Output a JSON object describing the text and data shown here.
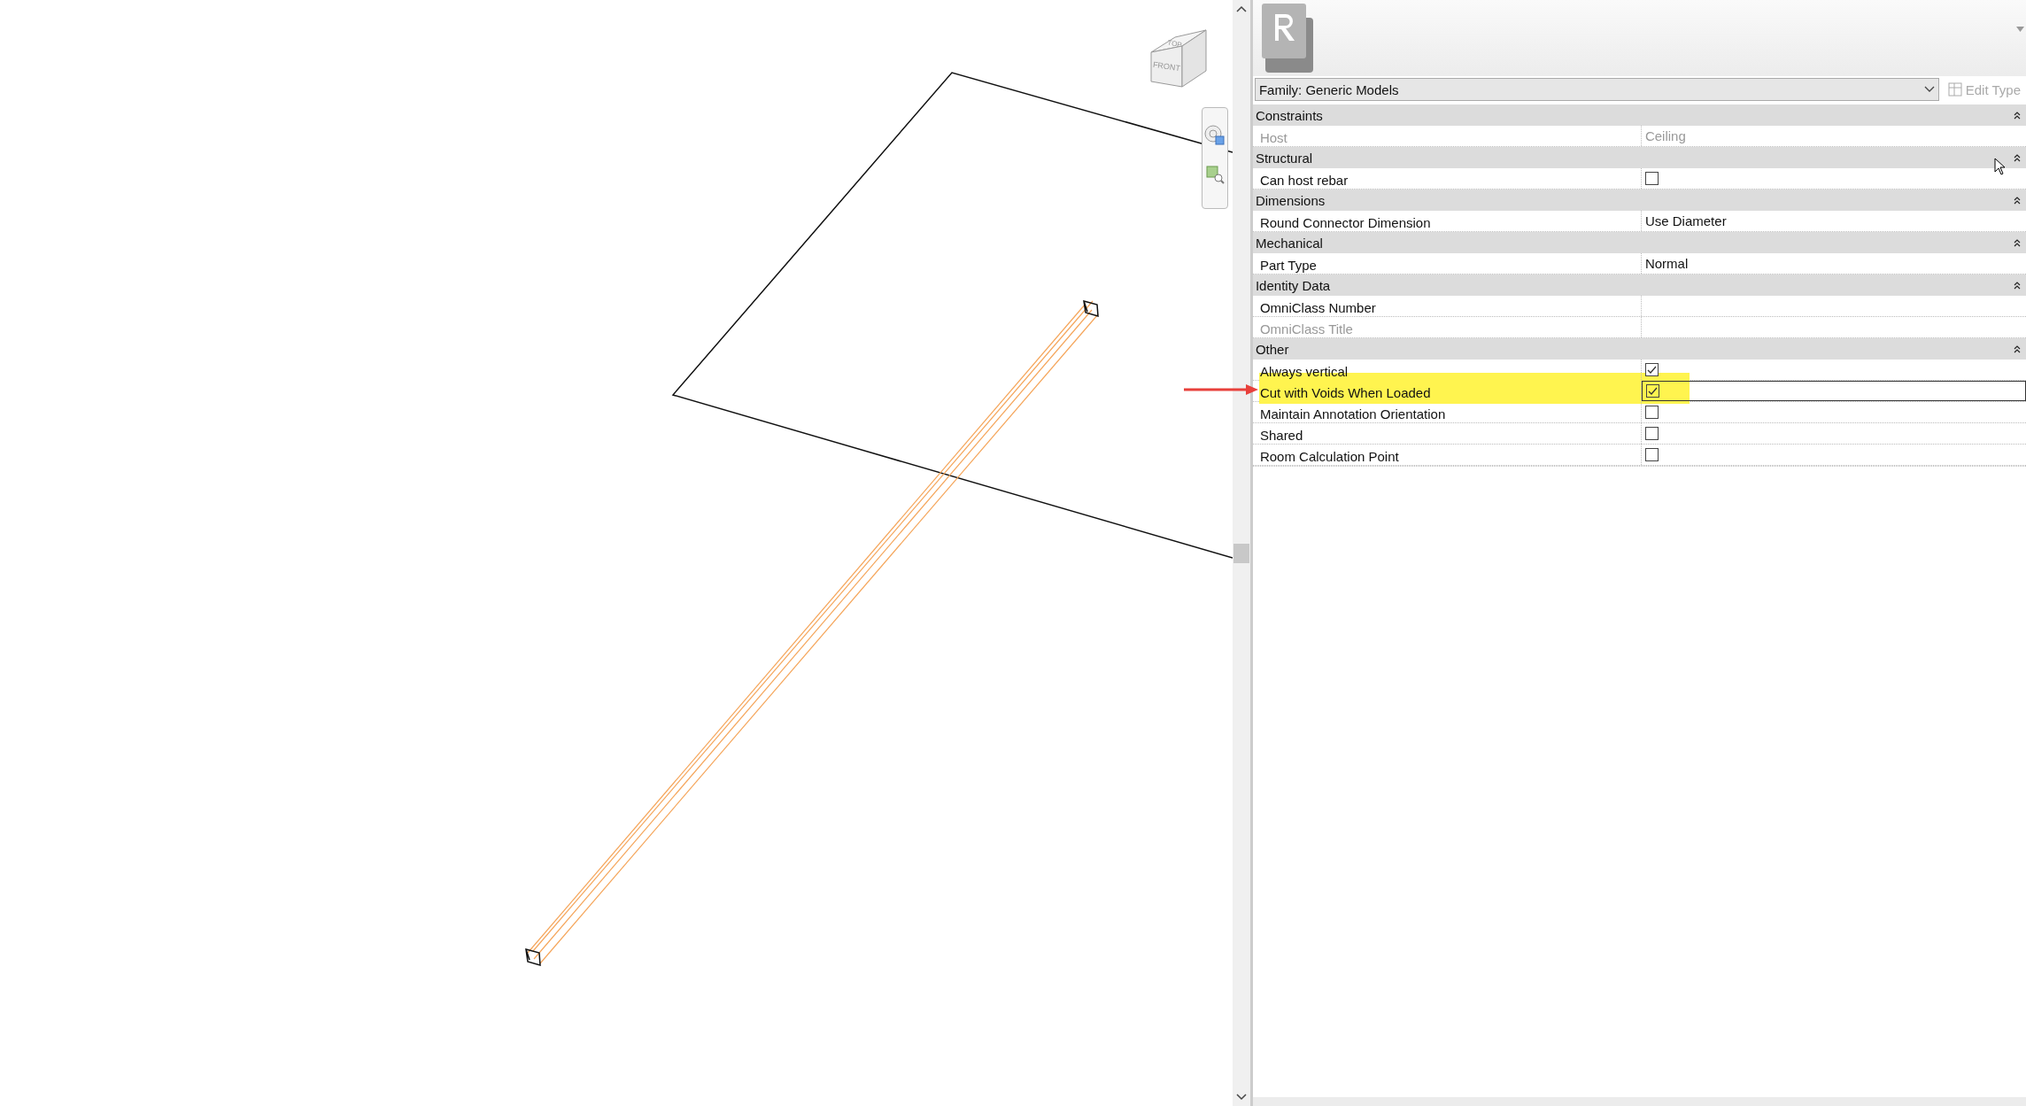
{
  "viewport": {
    "view_cube": {
      "faces": [
        "TOP",
        "FRONT"
      ]
    }
  },
  "properties": {
    "type_selector": "Family: Generic Models",
    "edit_type": {
      "label": "Edit Type",
      "disabled": true
    },
    "groups": [
      {
        "name": "Constraints",
        "expanded": true,
        "rows": [
          {
            "kind": "text",
            "label": "Host",
            "value": "Ceiling",
            "disabled": true,
            "selected": false,
            "highlighted": false
          }
        ]
      },
      {
        "name": "Structural",
        "expanded": true,
        "rows": [
          {
            "kind": "checkbox",
            "label": "Can host rebar",
            "checked": false,
            "disabled": false,
            "selected": false,
            "highlighted": false
          }
        ]
      },
      {
        "name": "Dimensions",
        "expanded": true,
        "rows": [
          {
            "kind": "text",
            "label": "Round Connector Dimension",
            "value": "Use Diameter",
            "disabled": false,
            "selected": false,
            "highlighted": false
          }
        ]
      },
      {
        "name": "Mechanical",
        "expanded": true,
        "rows": [
          {
            "kind": "text",
            "label": "Part Type",
            "value": "Normal",
            "disabled": false,
            "selected": false,
            "highlighted": false
          }
        ]
      },
      {
        "name": "Identity Data",
        "expanded": true,
        "rows": [
          {
            "kind": "text",
            "label": "OmniClass Number",
            "value": "",
            "disabled": false,
            "selected": false,
            "highlighted": false
          },
          {
            "kind": "text",
            "label": "OmniClass Title",
            "value": "",
            "disabled": true,
            "selected": false,
            "highlighted": false
          }
        ]
      },
      {
        "name": "Other",
        "expanded": true,
        "rows": [
          {
            "kind": "checkbox",
            "label": "Always vertical",
            "checked": true,
            "disabled": false,
            "selected": false,
            "highlighted": false
          },
          {
            "kind": "checkbox",
            "label": "Cut with Voids When Loaded",
            "checked": true,
            "disabled": false,
            "selected": true,
            "highlighted": true
          },
          {
            "kind": "checkbox",
            "label": "Maintain Annotation Orientation",
            "checked": false,
            "disabled": false,
            "selected": false,
            "highlighted": false
          },
          {
            "kind": "checkbox",
            "label": "Shared",
            "checked": false,
            "disabled": false,
            "selected": false,
            "highlighted": false
          },
          {
            "kind": "checkbox",
            "label": "Room Calculation Point",
            "checked": false,
            "disabled": false,
            "selected": false,
            "highlighted": false
          }
        ]
      }
    ]
  }
}
